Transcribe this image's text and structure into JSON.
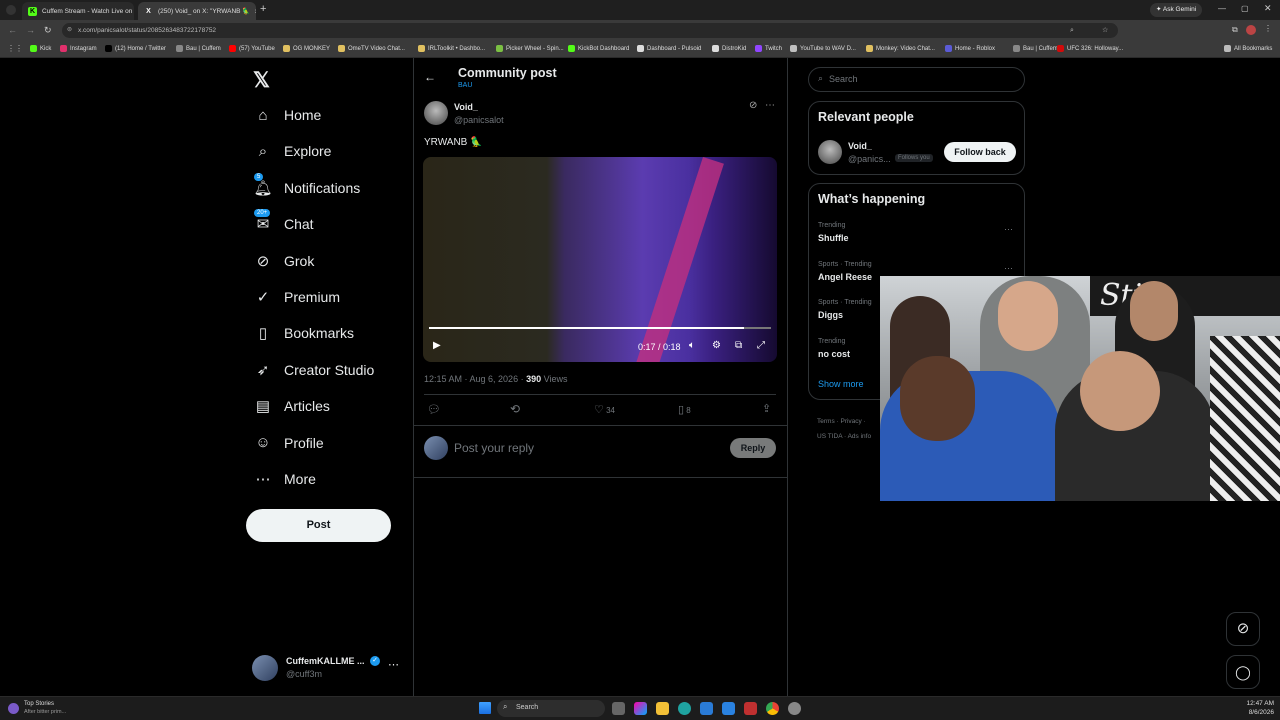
{
  "browser": {
    "tabs": [
      {
        "title": "Cuffem Stream - Watch Live on",
        "favicon_color": "#53fc18",
        "favicon_letter": "K"
      },
      {
        "title": "(250) Void_ on X: \"YRWANB 🦜",
        "favicon_color": "#000000",
        "favicon_letter": "X"
      }
    ],
    "url": "x.com/panicsalot/status/2085263483722178752",
    "ask_gemini": "Ask Gemini",
    "all_bookmarks": "All Bookmarks",
    "bookmarks": [
      {
        "label": "Kick",
        "color": "#53fc18"
      },
      {
        "label": "Instagram",
        "color": "#e1306c"
      },
      {
        "label": "(12) Home / Twitter",
        "color": "#000000"
      },
      {
        "label": "Bau | Cuffem",
        "color": "#888888"
      },
      {
        "label": "(57) YouTube",
        "color": "#ff0000"
      },
      {
        "label": "OG MONKEY",
        "color": "#e0c060"
      },
      {
        "label": "OmeTV Video Chat...",
        "color": "#e0c060"
      },
      {
        "label": "IRLToolkit • Dashbo...",
        "color": "#e0c060"
      },
      {
        "label": "Picker Wheel - Spin...",
        "color": "#7bc043"
      },
      {
        "label": "KickBot Dashboard",
        "color": "#53fc18"
      },
      {
        "label": "Dashboard - Pulsoid",
        "color": "#dddddd"
      },
      {
        "label": "DistroKid",
        "color": "#dddddd"
      },
      {
        "label": "Twitch",
        "color": "#9146ff"
      },
      {
        "label": "YouTube to WAV D...",
        "color": "#c0c0c0"
      },
      {
        "label": "Monkey: Video Chat...",
        "color": "#e0c060"
      },
      {
        "label": "Home - Roblox",
        "color": "#5b5bd6"
      },
      {
        "label": "Bau | Cuffem",
        "color": "#888888"
      },
      {
        "label": "UFC 326: Holloway...",
        "color": "#d20a0a"
      }
    ]
  },
  "nav": {
    "items": [
      {
        "label": "Home",
        "icon": "home-icon"
      },
      {
        "label": "Explore",
        "icon": "search-icon"
      },
      {
        "label": "Notifications",
        "icon": "bell-icon",
        "badge": "5"
      },
      {
        "label": "Chat",
        "icon": "mail-icon",
        "badge": "20+"
      },
      {
        "label": "Grok",
        "icon": "grok-icon"
      },
      {
        "label": "Premium",
        "icon": "verified-icon"
      },
      {
        "label": "Bookmarks",
        "icon": "bookmark-icon"
      },
      {
        "label": "Creator Studio",
        "icon": "rocket-icon"
      },
      {
        "label": "Articles",
        "icon": "article-icon"
      },
      {
        "label": "Profile",
        "icon": "person-icon"
      },
      {
        "label": "More",
        "icon": "more-icon"
      }
    ],
    "post_label": "Post",
    "account": {
      "name": "CuffemKALLME ...",
      "handle": "@cuff3m"
    }
  },
  "post": {
    "header_title": "Community post",
    "community": "BAU",
    "author_name": "Void_",
    "author_handle": "@panicsalot",
    "text": "YRWANB 🦜",
    "video": {
      "time": "0:17 / 0:18",
      "progress": 0.92
    },
    "timestamp": "12:15 AM · Aug 6, 2026 ·",
    "views_count": "390",
    "views_label": "Views",
    "likes": "34",
    "bookmarks": "8",
    "reply_placeholder": "Post your reply",
    "reply_button": "Reply"
  },
  "sidebar": {
    "search_placeholder": "Search",
    "relevant_title": "Relevant people",
    "relevant_person": {
      "name": "Void_",
      "handle": "@panics...",
      "follows_you": "Follows you",
      "follow_label": "Follow back"
    },
    "happening_title": "What’s happening",
    "trends": [
      {
        "context": "Trending",
        "name": "Shuffle"
      },
      {
        "context": "Sports · Trending",
        "name": "Angel Reese"
      },
      {
        "context": "Sports · Trending",
        "name": "Diggs"
      },
      {
        "context": "Trending",
        "name": "no cost"
      }
    ],
    "show_more": "Show more",
    "footer": [
      "Terms",
      "Privacy",
      "US TIDA",
      "Ads info"
    ]
  },
  "taskbar": {
    "news_title": "Top Stories",
    "news_sub": "After bitter prim...",
    "search": "Search",
    "time": "12:47 AM",
    "date": "8/6/2026"
  },
  "colors": {
    "accent": "#1d9bf0",
    "text": "#e7e9ea",
    "muted": "#71767b",
    "border": "#2f3336"
  }
}
